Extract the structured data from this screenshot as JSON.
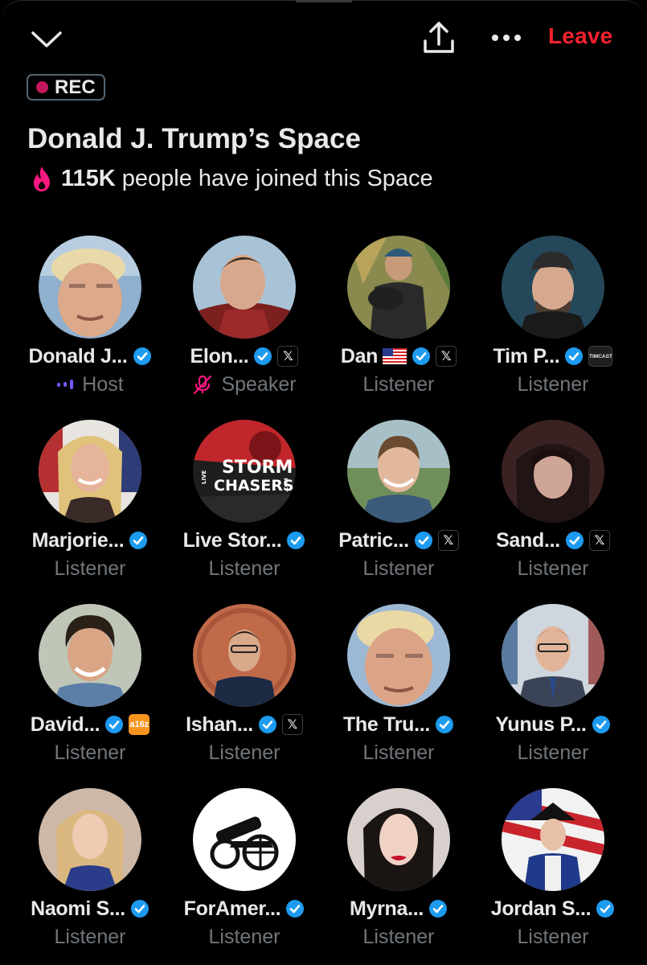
{
  "header": {
    "leave_label": "Leave",
    "collapse_icon": "chevron-down-icon",
    "share_icon": "share-icon",
    "more_icon": "more-icon"
  },
  "rec": {
    "label": "REC",
    "color": "#c2185b"
  },
  "space": {
    "title": "Donald J. Trump’s Space",
    "joined_count": "115K",
    "joined_text": "people have joined this Space"
  },
  "colors": {
    "leave": "#f4212e",
    "verified": "#1d9bf0",
    "role": "#71767b"
  },
  "participants": [
    {
      "name": "Donald J...",
      "role": "Host",
      "role_icon": "audio-wave-icon",
      "badge": null
    },
    {
      "name": "Elon...",
      "role": "Speaker",
      "role_icon": "muted-mic-icon",
      "badge": "X"
    },
    {
      "name": "Dan",
      "role": "Listener",
      "flag": "🇺🇸",
      "badge": "X"
    },
    {
      "name": "Tim P...",
      "role": "Listener",
      "badge": "TIMCAST"
    },
    {
      "name": "Marjorie...",
      "role": "Listener",
      "badge": null
    },
    {
      "name": "Live Stor...",
      "role": "Listener",
      "badge": null,
      "avatar_text": [
        "LIVE",
        "STORM",
        "CHASERS",
        ".COM"
      ]
    },
    {
      "name": "Patric...",
      "role": "Listener",
      "badge": "X"
    },
    {
      "name": "Sand...",
      "role": "Listener",
      "badge": "X"
    },
    {
      "name": "David...",
      "role": "Listener",
      "badge": "a16z"
    },
    {
      "name": "Ishan...",
      "role": "Listener",
      "badge": "X"
    },
    {
      "name": "The Tru...",
      "role": "Listener",
      "badge": null
    },
    {
      "name": "Yunus P...",
      "role": "Listener",
      "badge": null
    },
    {
      "name": "Naomi S...",
      "role": "Listener",
      "badge": null
    },
    {
      "name": "ForAmer...",
      "role": "Listener",
      "badge": null
    },
    {
      "name": "Myrna...",
      "role": "Listener",
      "badge": null
    },
    {
      "name": "Jordan S...",
      "role": "Listener",
      "badge": null
    }
  ]
}
